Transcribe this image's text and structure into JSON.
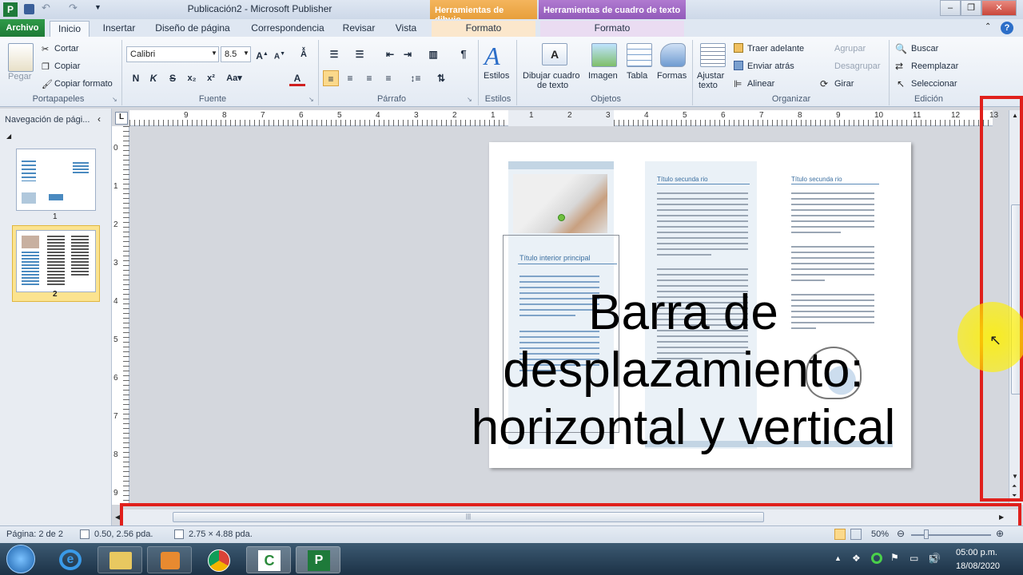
{
  "window": {
    "title": "Publicación2 - Microsoft Publisher",
    "context_tab_drawing": "Herramientas de dibujo",
    "context_tab_textbox": "Herramientas de cuadro de texto",
    "minimize": "–",
    "restore": "❐",
    "close": "✕"
  },
  "tabs": {
    "archivo": "Archivo",
    "inicio": "Inicio",
    "insertar": "Insertar",
    "diseno": "Diseño de página",
    "correspondencia": "Correspondencia",
    "revisar": "Revisar",
    "vista": "Vista",
    "formato1": "Formato",
    "formato2": "Formato"
  },
  "ribbon": {
    "portapapeles": {
      "label": "Portapapeles",
      "pegar": "Pegar",
      "cortar": "Cortar",
      "copiar": "Copiar",
      "copiar_formato": "Copiar formato"
    },
    "fuente": {
      "label": "Fuente",
      "font_name": "Calibri",
      "font_size": "8.5",
      "bold": "N",
      "italic": "K",
      "strike": "S"
    },
    "parrafo": {
      "label": "Párrafo"
    },
    "estilos": {
      "label": "Estilos",
      "estilos_btn": "Estilos"
    },
    "objetos": {
      "label": "Objetos",
      "dibujar": "Dibujar cuadro\nde texto",
      "dibujar1": "Dibujar cuadro",
      "dibujar2": "de texto",
      "imagen": "Imagen",
      "tabla": "Tabla",
      "formas": "Formas"
    },
    "organizar": {
      "label": "Organizar",
      "ajustar1": "Ajustar",
      "ajustar2": "texto",
      "traer": "Traer adelante",
      "enviar": "Enviar atrás",
      "alinear": "Alinear",
      "agrupar": "Agrupar",
      "desagrupar": "Desagrupar",
      "girar": "Girar"
    },
    "edicion": {
      "label": "Edición",
      "buscar": "Buscar",
      "reemplazar": "Reemplazar",
      "seleccionar": "Seleccionar"
    }
  },
  "nav": {
    "title": "Navegación de pági...",
    "pages": [
      "1",
      "2"
    ]
  },
  "ruler": {
    "h_ticks": [
      "9",
      "8",
      "7",
      "6",
      "5",
      "4",
      "3",
      "2",
      "1",
      "1",
      "2",
      "3",
      "4",
      "5",
      "6",
      "7",
      "8",
      "9",
      "10",
      "11",
      "12",
      "13"
    ],
    "v_ticks": [
      "0",
      "1",
      "2",
      "3",
      "4",
      "5",
      "6",
      "7",
      "8",
      "9"
    ]
  },
  "document": {
    "panel1_title": "Título interior principal",
    "panel2_title": "Título secunda rio",
    "panel3_title": "Título secunda rio"
  },
  "overlay": {
    "line1": "Barra de",
    "line2": "desplazamiento:",
    "line3": "horizontal y vertical"
  },
  "status": {
    "page": "Página: 2 de 2",
    "position": "0.50, 2.56 pda.",
    "size": "2.75 × 4.88 pda.",
    "zoom": "50%"
  },
  "taskbar": {
    "time": "05:00 p.m.",
    "date": "18/08/2020"
  },
  "colors": {
    "highlight_red": "#e0201c",
    "archivo_green": "#1d7a36",
    "ctx_orange": "#e59b35",
    "ctx_purple": "#8d55b6"
  }
}
